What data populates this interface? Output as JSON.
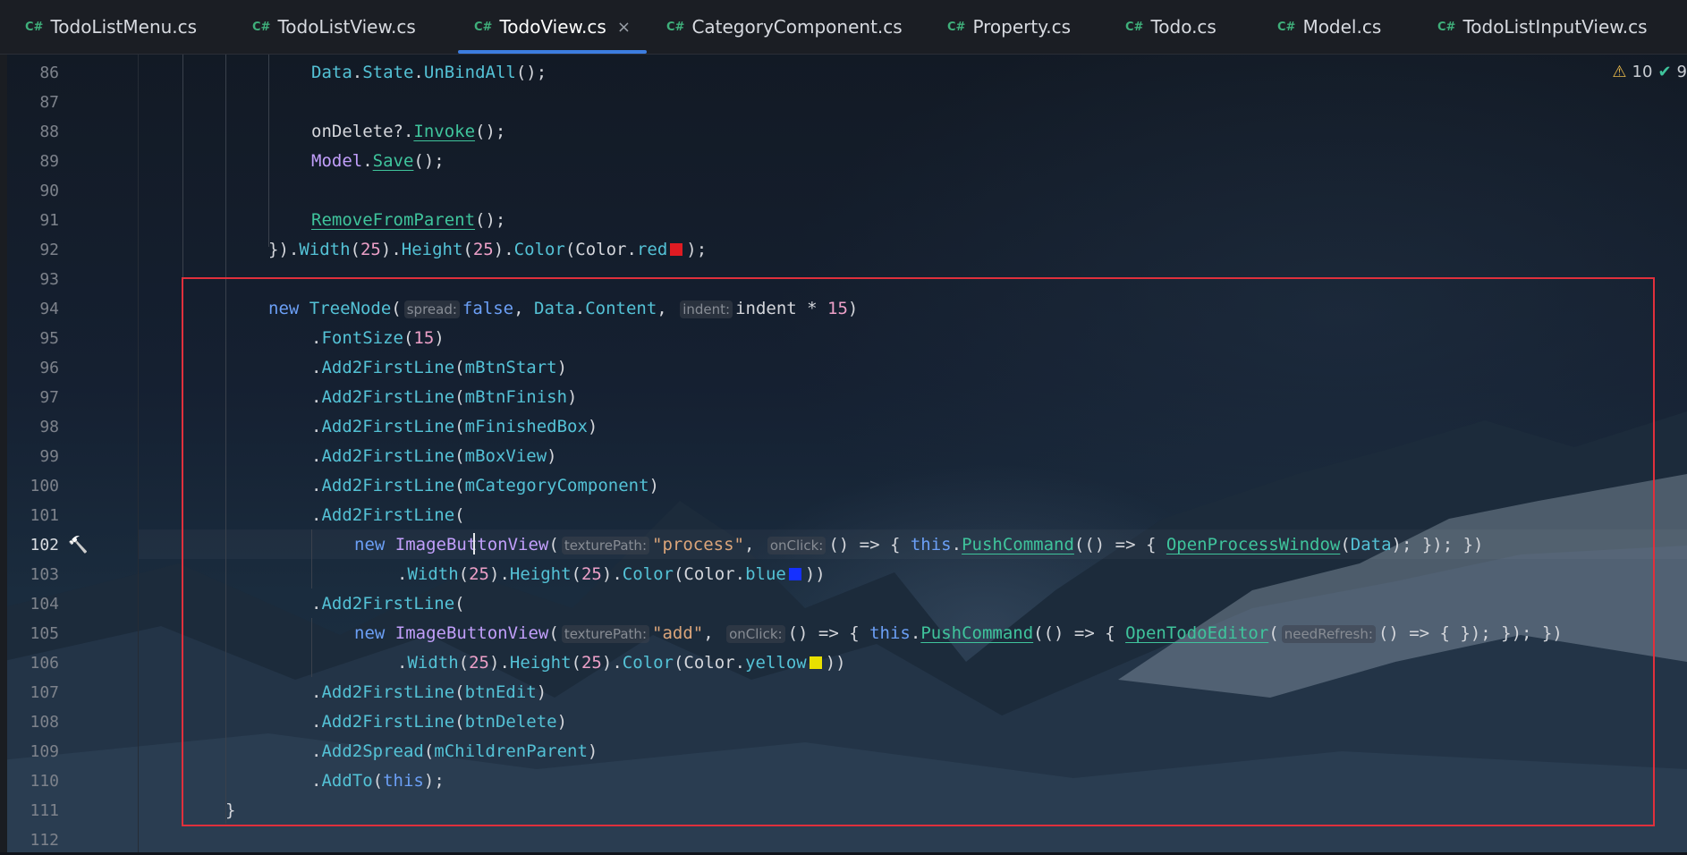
{
  "tabs": [
    {
      "lang": "C#",
      "label": "TodoListMenu.cs"
    },
    {
      "lang": "C#",
      "label": "TodoListView.cs"
    },
    {
      "lang": "C#",
      "label": "TodoView.cs",
      "active": true
    },
    {
      "lang": "C#",
      "label": "CategoryComponent.cs"
    },
    {
      "lang": "C#",
      "label": "Property.cs"
    },
    {
      "lang": "C#",
      "label": "Todo.cs"
    },
    {
      "lang": "C#",
      "label": "Model.cs"
    },
    {
      "lang": "C#",
      "label": "TodoListInputView.cs"
    }
  ],
  "close_glyph": "×",
  "status": {
    "warnings": "10",
    "ok": "9"
  },
  "icons": {
    "warning": "warning-triangle-icon",
    "ok": "check-icon",
    "hammer": "hammer-icon"
  },
  "colors": {
    "red": "#e01b22",
    "blue": "#1530ff",
    "yellow": "#e8e000",
    "accent": "#3c7de0",
    "highlight": "#e0303c"
  },
  "lines": [
    {
      "n": "86",
      "tokens": [
        [
          "me",
          "Data"
        ],
        [
          "pl",
          "."
        ],
        [
          "me",
          "State"
        ],
        [
          "pl",
          "."
        ],
        [
          "me",
          "UnBindAll"
        ],
        [
          "pl",
          "();"
        ]
      ]
    },
    {
      "n": "87",
      "tokens": []
    },
    {
      "n": "88",
      "tokens": [
        [
          "pl",
          "onDelete?."
        ],
        [
          "fn",
          "Invoke"
        ],
        [
          "pl",
          "();"
        ]
      ]
    },
    {
      "n": "89",
      "tokens": [
        [
          "ty",
          "Model"
        ],
        [
          "pl",
          "."
        ],
        [
          "fn",
          "Save"
        ],
        [
          "pl",
          "();"
        ]
      ]
    },
    {
      "n": "90",
      "tokens": []
    },
    {
      "n": "91",
      "tokens": [
        [
          "fn",
          "RemoveFromParent"
        ],
        [
          "pl",
          "();"
        ]
      ]
    },
    {
      "n": "92",
      "tokens": [
        [
          "pl",
          "})."
        ],
        [
          "me",
          "Width"
        ],
        [
          "pl",
          "("
        ],
        [
          "nm",
          "25"
        ],
        [
          "pl",
          ")."
        ],
        [
          "me",
          "Height"
        ],
        [
          "pl",
          "("
        ],
        [
          "nm",
          "25"
        ],
        [
          "pl",
          ")."
        ],
        [
          "me",
          "Color"
        ],
        [
          "pl",
          "("
        ],
        [
          "pl",
          "Color"
        ],
        [
          "pl",
          "."
        ],
        [
          "me",
          "red"
        ],
        [
          "sw",
          "red"
        ],
        [
          "pl",
          ");"
        ]
      ]
    },
    {
      "n": "93",
      "tokens": []
    },
    {
      "n": "94",
      "tokens": [
        [
          "kw",
          "new "
        ],
        [
          "me",
          "TreeNode"
        ],
        [
          "pl",
          "("
        ],
        [
          "hint",
          "spread:"
        ],
        [
          "kw",
          "false"
        ],
        [
          "pl",
          ", "
        ],
        [
          "me",
          "Data"
        ],
        [
          "pl",
          "."
        ],
        [
          "me",
          "Content"
        ],
        [
          "pl",
          ", "
        ],
        [
          "hint",
          "indent:"
        ],
        [
          "pl",
          "indent * "
        ],
        [
          "nm",
          "15"
        ],
        [
          "pl",
          ")"
        ]
      ]
    },
    {
      "n": "95",
      "tokens": [
        [
          "pl",
          "."
        ],
        [
          "me",
          "FontSize"
        ],
        [
          "pl",
          "("
        ],
        [
          "nm",
          "15"
        ],
        [
          "pl",
          ")"
        ]
      ]
    },
    {
      "n": "96",
      "tokens": [
        [
          "pl",
          "."
        ],
        [
          "me",
          "Add2FirstLine"
        ],
        [
          "pl",
          "("
        ],
        [
          "me",
          "mBtnStart"
        ],
        [
          "pl",
          ")"
        ]
      ]
    },
    {
      "n": "97",
      "tokens": [
        [
          "pl",
          "."
        ],
        [
          "me",
          "Add2FirstLine"
        ],
        [
          "pl",
          "("
        ],
        [
          "me",
          "mBtnFinish"
        ],
        [
          "pl",
          ")"
        ]
      ]
    },
    {
      "n": "98",
      "tokens": [
        [
          "pl",
          "."
        ],
        [
          "me",
          "Add2FirstLine"
        ],
        [
          "pl",
          "("
        ],
        [
          "me",
          "mFinishedBox"
        ],
        [
          "pl",
          ")"
        ]
      ]
    },
    {
      "n": "99",
      "tokens": [
        [
          "pl",
          "."
        ],
        [
          "me",
          "Add2FirstLine"
        ],
        [
          "pl",
          "("
        ],
        [
          "me",
          "mBoxView"
        ],
        [
          "pl",
          ")"
        ]
      ]
    },
    {
      "n": "100",
      "tokens": [
        [
          "pl",
          "."
        ],
        [
          "me",
          "Add2FirstLine"
        ],
        [
          "pl",
          "("
        ],
        [
          "me",
          "mCategoryComponent"
        ],
        [
          "pl",
          ")"
        ]
      ]
    },
    {
      "n": "101",
      "tokens": [
        [
          "pl",
          "."
        ],
        [
          "me",
          "Add2FirstLine"
        ],
        [
          "pl",
          "("
        ]
      ]
    },
    {
      "n": "102",
      "tokens": [
        [
          "kw",
          "new "
        ],
        [
          "ty",
          "ImageButtonView"
        ],
        [
          "pl",
          "("
        ],
        [
          "hint",
          "texturePath:"
        ],
        [
          "st",
          "\"process\""
        ],
        [
          "pl",
          ", "
        ],
        [
          "hint",
          "onClick:"
        ],
        [
          "pl",
          "() => { "
        ],
        [
          "kw",
          "this"
        ],
        [
          "pl",
          "."
        ],
        [
          "fn",
          "PushCommand"
        ],
        [
          "pl",
          "(() => { "
        ],
        [
          "fn",
          "OpenProcessWindow"
        ],
        [
          "pl",
          "("
        ],
        [
          "me",
          "Data"
        ],
        [
          "pl",
          "); }); })"
        ]
      ]
    },
    {
      "n": "103",
      "tokens": [
        [
          "pl",
          "."
        ],
        [
          "me",
          "Width"
        ],
        [
          "pl",
          "("
        ],
        [
          "nm",
          "25"
        ],
        [
          "pl",
          ")."
        ],
        [
          "me",
          "Height"
        ],
        [
          "pl",
          "("
        ],
        [
          "nm",
          "25"
        ],
        [
          "pl",
          ")."
        ],
        [
          "me",
          "Color"
        ],
        [
          "pl",
          "("
        ],
        [
          "pl",
          "Color"
        ],
        [
          "pl",
          "."
        ],
        [
          "me",
          "blue"
        ],
        [
          "sw",
          "blue"
        ],
        [
          "pl",
          "))"
        ]
      ]
    },
    {
      "n": "104",
      "tokens": [
        [
          "pl",
          "."
        ],
        [
          "me",
          "Add2FirstLine"
        ],
        [
          "pl",
          "("
        ]
      ]
    },
    {
      "n": "105",
      "tokens": [
        [
          "kw",
          "new "
        ],
        [
          "ty",
          "ImageButtonView"
        ],
        [
          "pl",
          "("
        ],
        [
          "hint",
          "texturePath:"
        ],
        [
          "st",
          "\"add\""
        ],
        [
          "pl",
          ", "
        ],
        [
          "hint",
          "onClick:"
        ],
        [
          "pl",
          "() => { "
        ],
        [
          "kw",
          "this"
        ],
        [
          "pl",
          "."
        ],
        [
          "fn",
          "PushCommand"
        ],
        [
          "pl",
          "(() => { "
        ],
        [
          "fn",
          "OpenTodoEditor"
        ],
        [
          "pl",
          "("
        ],
        [
          "hint",
          "needRefresh:"
        ],
        [
          "pl",
          "() => { }); }); })"
        ]
      ]
    },
    {
      "n": "106",
      "tokens": [
        [
          "pl",
          "."
        ],
        [
          "me",
          "Width"
        ],
        [
          "pl",
          "("
        ],
        [
          "nm",
          "25"
        ],
        [
          "pl",
          ")."
        ],
        [
          "me",
          "Height"
        ],
        [
          "pl",
          "("
        ],
        [
          "nm",
          "25"
        ],
        [
          "pl",
          ")."
        ],
        [
          "me",
          "Color"
        ],
        [
          "pl",
          "("
        ],
        [
          "pl",
          "Color"
        ],
        [
          "pl",
          "."
        ],
        [
          "me",
          "yellow"
        ],
        [
          "sw",
          "yellow"
        ],
        [
          "pl",
          "))"
        ]
      ]
    },
    {
      "n": "107",
      "tokens": [
        [
          "pl",
          "."
        ],
        [
          "me",
          "Add2FirstLine"
        ],
        [
          "pl",
          "("
        ],
        [
          "me",
          "btnEdit"
        ],
        [
          "pl",
          ")"
        ]
      ]
    },
    {
      "n": "108",
      "tokens": [
        [
          "pl",
          "."
        ],
        [
          "me",
          "Add2FirstLine"
        ],
        [
          "pl",
          "("
        ],
        [
          "me",
          "btnDelete"
        ],
        [
          "pl",
          ")"
        ]
      ]
    },
    {
      "n": "109",
      "tokens": [
        [
          "pl",
          "."
        ],
        [
          "me",
          "Add2Spread"
        ],
        [
          "pl",
          "("
        ],
        [
          "me",
          "mChildrenParent"
        ],
        [
          "pl",
          ")"
        ]
      ]
    },
    {
      "n": "110",
      "tokens": [
        [
          "pl",
          "."
        ],
        [
          "me",
          "AddTo"
        ],
        [
          "pl",
          "("
        ],
        [
          "kw",
          "this"
        ],
        [
          "pl",
          ");"
        ]
      ]
    },
    {
      "n": "111",
      "tokens": [
        [
          "pl",
          "}"
        ]
      ]
    },
    {
      "n": "112",
      "tokens": []
    }
  ]
}
